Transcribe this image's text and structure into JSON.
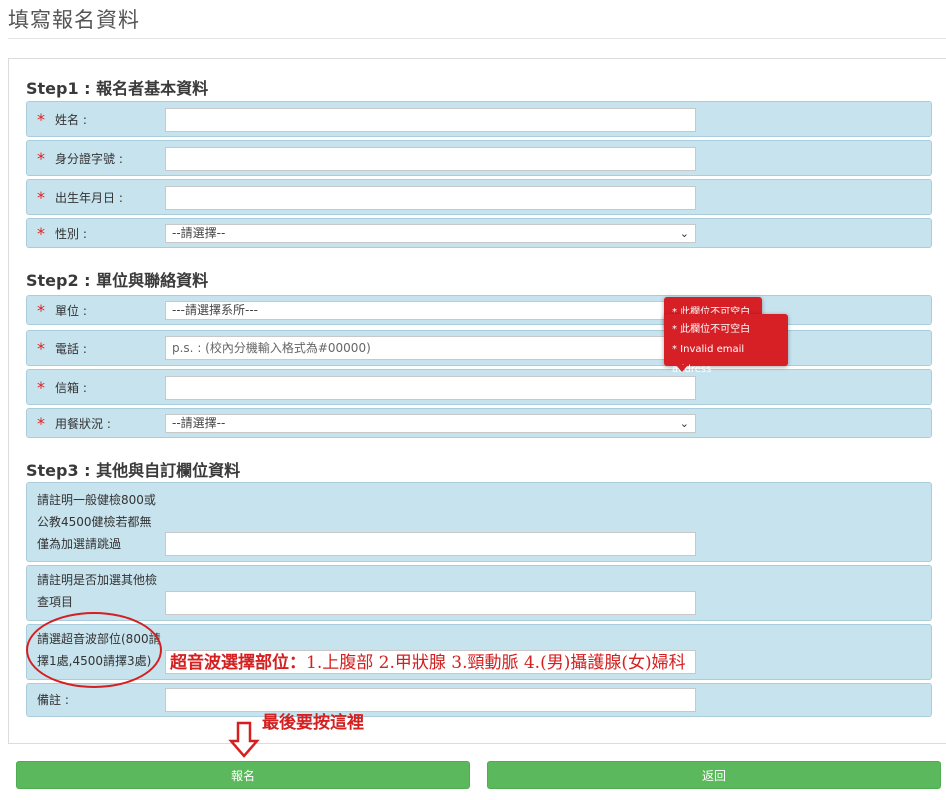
{
  "page": {
    "title": "填寫報名資料"
  },
  "step1": {
    "title": "Step1 : 報名者基本資料",
    "fields": [
      {
        "label": "姓名 :",
        "required": "*",
        "value": ""
      },
      {
        "label": "身分證字號 :",
        "required": "*",
        "value": ""
      },
      {
        "label": "出生年月日 :",
        "required": "*",
        "value": ""
      },
      {
        "label": "性別 :",
        "required": "*",
        "value": "--請選擇--"
      }
    ]
  },
  "step2": {
    "title": "Step2 : 單位與聯絡資料",
    "fields": [
      {
        "label": "單位 :",
        "required": "*",
        "value": "---請選擇系所---"
      },
      {
        "label": "電話 :",
        "required": "*",
        "placeholder": "p.s. : (校內分機輸入格式為#00000)"
      },
      {
        "label": "信箱 :",
        "required": "*",
        "value": ""
      },
      {
        "label": "用餐狀況 :",
        "required": "*",
        "value": "--請選擇--"
      }
    ]
  },
  "step3": {
    "title": "Step3 : 其他與自訂欄位資料",
    "fields": [
      {
        "label": "請註明一般健檢800或公教4500健檢若都無僅為加選請跳過",
        "value": ""
      },
      {
        "label": "請註明是否加選其他檢查項目",
        "value": ""
      },
      {
        "label": "請選超音波部位(800請擇1處,4500請擇3處)",
        "value": ""
      },
      {
        "label": "備註 :",
        "value": ""
      }
    ]
  },
  "tooltips": {
    "back": "* 此欄位不可空白",
    "front_line1": "* 此欄位不可空白",
    "front_line2": "* Invalid email address"
  },
  "annotations": {
    "ultrasound_label": "超音波選擇部位：",
    "ultrasound_options": "1.上腹部 2.甲狀腺 3.頸動脈 4.(男)攝護腺(女)婦科",
    "click_here": "最後要按這裡"
  },
  "buttons": {
    "submit": "報名",
    "back": "返回"
  },
  "colors": {
    "row_bg": "#c7e3ee",
    "button": "#5cb85c",
    "error": "#d62026",
    "annotation": "#d42020"
  }
}
